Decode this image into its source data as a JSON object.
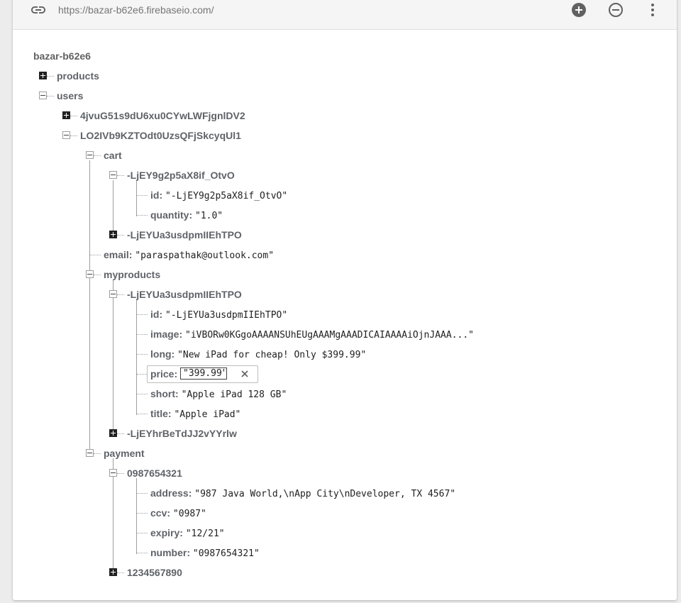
{
  "url_bar": {
    "url": "https://bazar-b62e6.firebaseio.com/",
    "icons": [
      "link-icon",
      "add-icon",
      "remove-icon",
      "more-vert-icon"
    ]
  },
  "tree": {
    "root": "bazar-b62e6",
    "products_key": "products",
    "users_key": "users",
    "user1_key": "4jvuG51s9dU6xu0CYwLWFjgnlDV2",
    "user2_key": "LO2IVb9KZTOdt0UzsQFjSkcyqUl1",
    "cart_key": "cart",
    "cart_item1_key": "-LjEY9g2p5aX8if_OtvO",
    "cart_item1_id_key": "id:",
    "cart_item1_id_val": "\"-LjEY9g2p5aX8if_OtvO\"",
    "cart_item1_qty_key": "quantity:",
    "cart_item1_qty_val": "\"1.0\"",
    "cart_item2_key": "-LjEYUa3usdpmIIEhTPO",
    "email_key": "email:",
    "email_val": "\"paraspathak@outlook.com\"",
    "myproducts_key": "myproducts",
    "myprod1_key": "-LjEYUa3usdpmIIEhTPO",
    "myprod1_id_key": "id:",
    "myprod1_id_val": "\"-LjEYUa3usdpmIIEhTPO\"",
    "myprod1_image_key": "image:",
    "myprod1_image_val": "\"iVBORw0KGgoAAAANSUhEUgAAAMgAAADICAIAAAAiOjnJAAA...\"",
    "myprod1_long_key": "long:",
    "myprod1_long_val": "\"New iPad for cheap! Only $399.99\"",
    "myprod1_price_key": "price:",
    "myprod1_price_val": "\"399.99\"",
    "myprod1_short_key": "short:",
    "myprod1_short_val": "\"Apple iPad 128 GB\"",
    "myprod1_title_key": "title:",
    "myprod1_title_val": "\"Apple iPad\"",
    "myprod2_key": "-LjEYhrBeTdJJ2vYYrlw",
    "payment_key": "payment",
    "pay1_key": "0987654321",
    "pay1_address_key": "address:",
    "pay1_address_val": "\"987 Java World,\\nApp City\\nDeveloper, TX 4567\"",
    "pay1_ccv_key": "ccv:",
    "pay1_ccv_val": "\"0987\"",
    "pay1_expiry_key": "expiry:",
    "pay1_expiry_val": "\"12/21\"",
    "pay1_number_key": "number:",
    "pay1_number_val": "\"0987654321\"",
    "pay2_key": "1234567890"
  },
  "colors": {
    "key_text": "#5f6368",
    "value_text": "#212121",
    "toolbar_icon": "#616161"
  }
}
